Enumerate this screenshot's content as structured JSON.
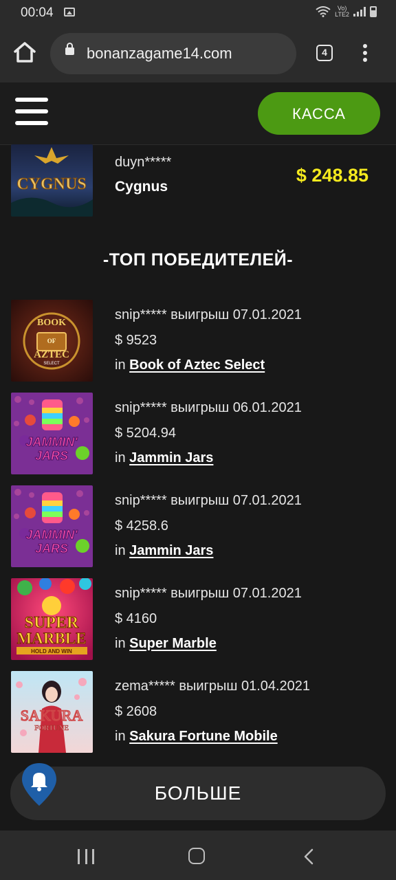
{
  "status_bar": {
    "time": "00:04",
    "network_top": "Vo)",
    "network_bottom": "LTE2"
  },
  "browser": {
    "url": "bonanzagame14.com",
    "tab_count": "4"
  },
  "header": {
    "cashier_label": "КАССА"
  },
  "recent_win": {
    "user": "duyn*****",
    "game": "Cygnus",
    "amount": "$ 248.85",
    "thumb_text": "CYGNUS"
  },
  "top_winners": {
    "title": "-ТОП ПОБЕДИТЕЛЕЙ-",
    "items": [
      {
        "line1": "snip***** выигрыш 07.01.2021",
        "amount": "$ 9523",
        "in": "in ",
        "game": "Book of Aztec Select",
        "thumb_top": "BOOK",
        "thumb_mid": "AZTEC",
        "thumb_sub": "SELECT",
        "thumb_of": "OF"
      },
      {
        "line1": "snip***** выигрыш 06.01.2021",
        "amount": "$ 5204.94",
        "in": "in ",
        "game": "Jammin Jars",
        "thumb_top": "JAMMIN'",
        "thumb_mid": "JARS"
      },
      {
        "line1": "snip***** выигрыш 07.01.2021",
        "amount": "$ 4258.6",
        "in": "in ",
        "game": "Jammin Jars",
        "thumb_top": "JAMMIN'",
        "thumb_mid": "JARS"
      },
      {
        "line1": "snip***** выигрыш 07.01.2021",
        "amount": "$ 4160",
        "in": "in ",
        "game": "Super Marble",
        "thumb_top": "SUPER",
        "thumb_mid": "MARBLE",
        "thumb_sub": "HOLD AND WIN"
      },
      {
        "line1": "zema***** выигрыш 01.04.2021",
        "amount": "$ 2608",
        "in": "in ",
        "game": "Sakura Fortune Mobile",
        "thumb_top": "SAKURA",
        "thumb_mid": "FORTUNE"
      }
    ]
  },
  "more_label": "БОЛЬШЕ",
  "colors": {
    "accent_green": "#4c9a13",
    "amount_yellow": "#f5ea1e",
    "bell_blue": "#1f5fa8"
  }
}
